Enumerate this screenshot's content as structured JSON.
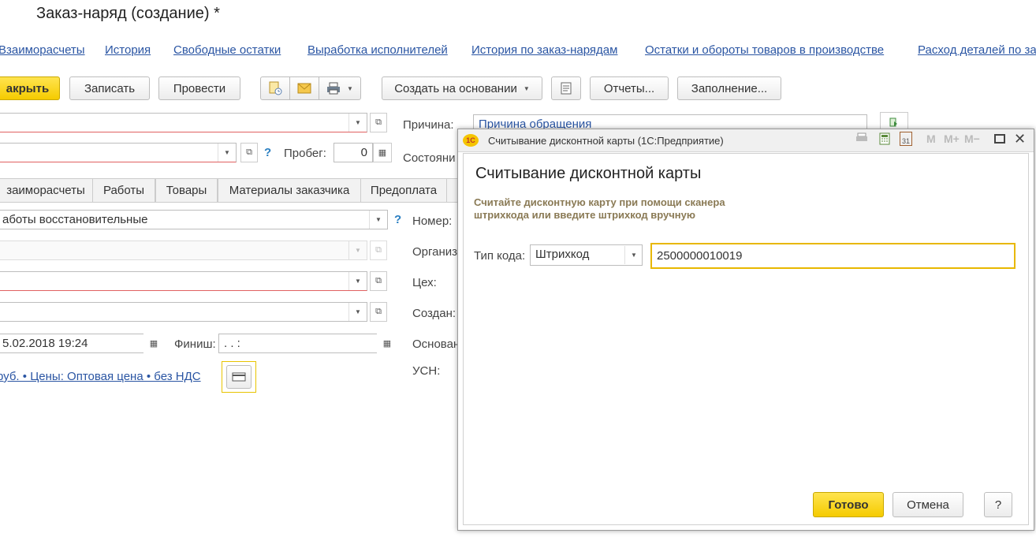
{
  "title": "Заказ-наряд (создание) *",
  "nav_links": [
    "Взаиморасчеты",
    "История",
    "Свободные остатки",
    "Выработка исполнителей",
    "История по заказ-нарядам",
    "Остатки и обороты товаров в производстве",
    "Расход деталей по за"
  ],
  "toolbar": {
    "close_label": "акрыть",
    "save_label": "Записать",
    "post_label": "Провести",
    "create_based_label": "Создать на основании",
    "reports_label": "Отчеты...",
    "fill_label": "Заполнение..."
  },
  "form": {
    "reason_label": "Причина:",
    "reason_value": "Причина обращения",
    "mileage_label": "Пробег:",
    "mileage_value": "0",
    "state_label": "Состояни",
    "work_type_value": "аботы восстановительные",
    "number_label": "Номер:",
    "org_label": "Организ",
    "shop_label": "Цех:",
    "created_label": "Создан:",
    "start_value": "5.02.2018 19:24",
    "finish_label": "Финиш:",
    "finish_value": " .  .      :",
    "basis_label": "Основан",
    "usn_label": "УСН:",
    "price_link": "руб. • Цены: Оптовая цена • без НДС",
    "help": "?"
  },
  "tabs": [
    "заиморасчеты",
    "Работы",
    "Товары",
    "Материалы заказчика",
    "Предоплата"
  ],
  "dialog": {
    "window_title": "Считывание дисконтной карты  (1С:Предприятие)",
    "app_logo": "1С",
    "heading": "Считывание дисконтной карты",
    "instruction_line1": "Считайте дисконтную карту при помощи сканера",
    "instruction_line2": "штрихкода или введите штрихкод вручную",
    "code_type_label": "Тип кода:",
    "code_type_value": "Штрихкод",
    "barcode_value": "2500000010019",
    "ok_label": "Готово",
    "cancel_label": "Отмена",
    "help_label": "?",
    "title_buttons": {
      "m": "M",
      "mplus": "M+",
      "mminus": "M−",
      "calendar_day": "31"
    }
  },
  "colors": {
    "accent_yellow": "#f5cb00",
    "link_blue": "#2a55a3",
    "focus_border": "#e8b800"
  }
}
